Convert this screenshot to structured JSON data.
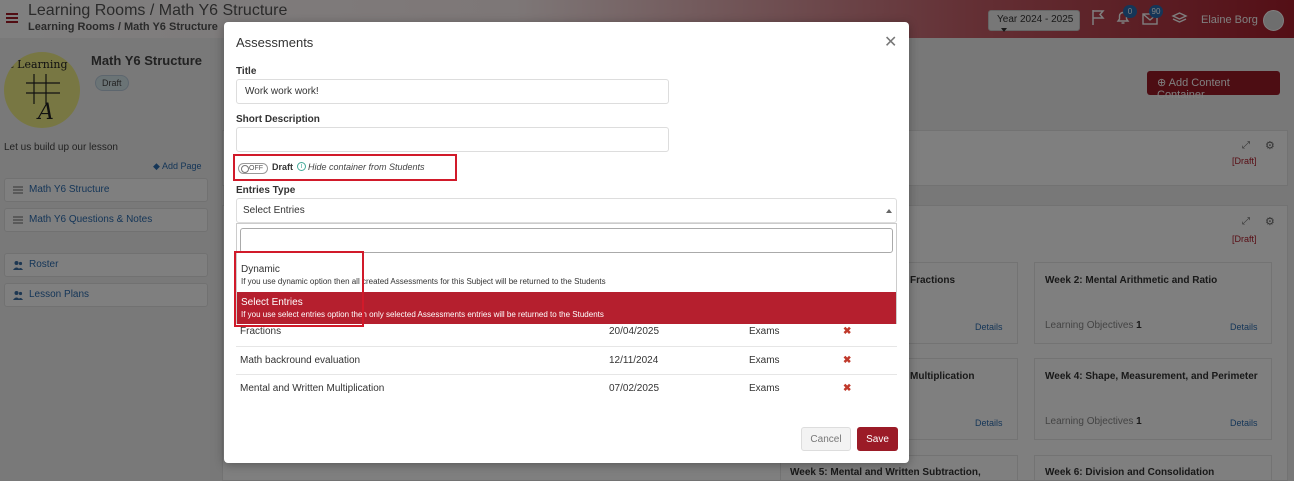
{
  "header": {
    "breadcrumb_main": "Learning Rooms / Math Y6 Structure",
    "breadcrumb_sub": "Learning Rooms / Math Y6 Structure",
    "year": "Year 2024 - 2025",
    "notifications_count": "0",
    "messages_count": "90",
    "user_name": "Elaine Borg"
  },
  "sidebar": {
    "logo_text": "rt Learning",
    "logo_glyph": "A",
    "title": "Math Y6 Structure",
    "status": "Draft",
    "description": "Let us build up our lesson",
    "add_page": "Add Page",
    "items": [
      {
        "label": "Math Y6 Structure"
      },
      {
        "label": "Math Y6 Questions & Notes"
      },
      {
        "label": "Roster"
      },
      {
        "label": "Lesson Plans"
      }
    ]
  },
  "main": {
    "add_container": "Add Content Container",
    "panel_status": "[Draft]",
    "cards": [
      {
        "title": "Fractions",
        "details": "Details"
      },
      {
        "title": "Week 2: Mental Arithmetic and Ratio",
        "meta_label": "Learning Objectives",
        "meta_value": "1",
        "details": "Details"
      },
      {
        "title": "Multiplication",
        "details": "Details"
      },
      {
        "title": "Week 4: Shape, Measurement, and Perimeter",
        "meta_label": "Learning Objectives",
        "meta_value": "1",
        "details": "Details"
      },
      {
        "title": "Week 5: Mental and Written Subtraction,"
      },
      {
        "title": "Week 6: Division and Consolidation"
      }
    ]
  },
  "modal": {
    "title": "Assessments",
    "title_label": "Title",
    "title_value": "Work work work!",
    "short_desc_label": "Short Description",
    "short_desc_value": "",
    "toggle_state": "OFF",
    "draft_label": "Draft",
    "draft_hint": "Hide container from Students",
    "entries_type_label": "Entries Type",
    "entries_selected": "Select Entries",
    "options": [
      {
        "title": "Dynamic",
        "desc": "If you use dynamic option then all created Assessments for this Subject will be returned to the Students"
      },
      {
        "title": "Select Entries",
        "desc": "If you use select entries option then only selected Assessments entries will be returned to the Students"
      }
    ],
    "rows": [
      {
        "name": "Fractions",
        "date": "20/04/2025",
        "type": "Exams"
      },
      {
        "name": "Math backround evaluation",
        "date": "12/11/2024",
        "type": "Exams"
      },
      {
        "name": "Mental and Written Multiplication",
        "date": "07/02/2025",
        "type": "Exams"
      }
    ],
    "cancel_label": "Cancel",
    "save_label": "Save"
  },
  "colors": {
    "brand": "#9b1b27",
    "selected_option": "#b51f2e",
    "link": "#2b6cb0",
    "highlight_box": "#d11a2a"
  }
}
